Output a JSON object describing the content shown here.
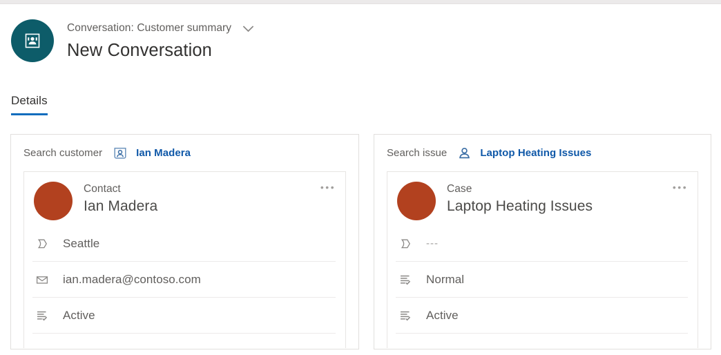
{
  "header": {
    "avatar_icon": "conversation-avatar-icon",
    "subtitle": "Conversation: Customer summary",
    "chevron_icon": "chevron-down-icon",
    "title": "New Conversation"
  },
  "tabs": [
    {
      "label": "Details",
      "selected": true
    }
  ],
  "colors": {
    "accent": "#0f6cbd",
    "link": "#0f58a8",
    "avatar_teal": "#0d5c69",
    "record_avatar": "#b2411f",
    "text_primary": "#323130",
    "text_secondary": "#605e5c",
    "border": "#e1dfdd"
  },
  "cards": [
    {
      "search": {
        "label": "Search customer",
        "icon": "contact-card-icon",
        "value": "Ian Madera"
      },
      "record": {
        "type": "Contact",
        "name": "Ian Madera",
        "more_label": "•••",
        "fields": [
          {
            "icon": "location-banner-icon",
            "value": "Seattle",
            "muted": false
          },
          {
            "icon": "email-icon",
            "value": "ian.madera@contoso.com",
            "muted": false
          },
          {
            "icon": "status-list-icon",
            "value": "Active",
            "muted": false
          }
        ]
      }
    },
    {
      "search": {
        "label": "Search issue",
        "icon": "case-person-icon",
        "value": "Laptop Heating Issues"
      },
      "record": {
        "type": "Case",
        "name": "Laptop Heating Issues",
        "more_label": "•••",
        "fields": [
          {
            "icon": "location-banner-icon",
            "value": "---",
            "muted": true
          },
          {
            "icon": "status-list-icon",
            "value": "Normal",
            "muted": false
          },
          {
            "icon": "status-list-icon",
            "value": "Active",
            "muted": false
          }
        ]
      }
    }
  ]
}
